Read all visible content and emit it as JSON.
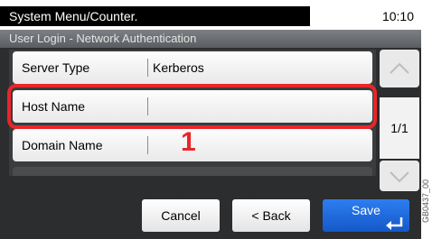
{
  "status": {
    "title": "System Menu/Counter.",
    "time": "10:10"
  },
  "header": {
    "title": "User Login - Network Authentication"
  },
  "rows": [
    {
      "label": "Server Type",
      "value": "Kerberos"
    },
    {
      "label": "Host Name",
      "value": ""
    },
    {
      "label": "Domain Name",
      "value": ""
    }
  ],
  "callout": {
    "number": "1"
  },
  "pager": {
    "indicator": "1/1"
  },
  "buttons": {
    "cancel": "Cancel",
    "back": "< Back",
    "save": "Save"
  },
  "side_code": "GB0437_00",
  "colors": {
    "highlight": "#e8262a",
    "save": "#1f6be0"
  },
  "icons": {
    "scroll_up": "chevron-up-icon",
    "scroll_down": "chevron-down-icon",
    "enter": "enter-arrow-icon"
  }
}
